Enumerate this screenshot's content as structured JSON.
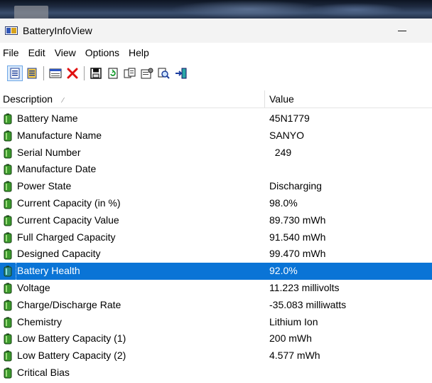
{
  "window": {
    "title": "BatteryInfoView"
  },
  "menu": [
    "File",
    "Edit",
    "View",
    "Options",
    "Help"
  ],
  "toolbar": {
    "buttons": [
      "properties-icon",
      "html-report-icon",
      "select-columns-icon",
      "close-x-icon",
      "save-icon",
      "refresh-icon",
      "copy-icon",
      "properties-window-icon",
      "find-icon",
      "exit-icon"
    ]
  },
  "table": {
    "columns": [
      "Description",
      "Value"
    ],
    "rows": [
      {
        "description": "Battery Name",
        "value": "45N1779"
      },
      {
        "description": "Manufacture Name",
        "value": "SANYO"
      },
      {
        "description": "Serial Number",
        "value": "  249"
      },
      {
        "description": "Manufacture Date",
        "value": ""
      },
      {
        "description": "Power State",
        "value": "Discharging"
      },
      {
        "description": "Current Capacity (in %)",
        "value": "98.0%"
      },
      {
        "description": "Current Capacity Value",
        "value": "89.730 mWh"
      },
      {
        "description": "Full Charged Capacity",
        "value": "91.540 mWh"
      },
      {
        "description": "Designed Capacity",
        "value": "99.470 mWh"
      },
      {
        "description": "Battery Health",
        "value": "92.0%"
      },
      {
        "description": "Voltage",
        "value": "11.223 millivolts"
      },
      {
        "description": "Charge/Discharge Rate",
        "value": "-35.083 milliwatts"
      },
      {
        "description": "Chemistry",
        "value": "Lithium Ion"
      },
      {
        "description": "Low Battery Capacity (1)",
        "value": "200 mWh"
      },
      {
        "description": "Low Battery Capacity (2)",
        "value": "4.577 mWh"
      },
      {
        "description": "Critical Bias",
        "value": ""
      }
    ],
    "selected_row": "Battery Health"
  },
  "colors": {
    "selection": "#0a74d6",
    "battery_green": "#3c9a2c"
  }
}
